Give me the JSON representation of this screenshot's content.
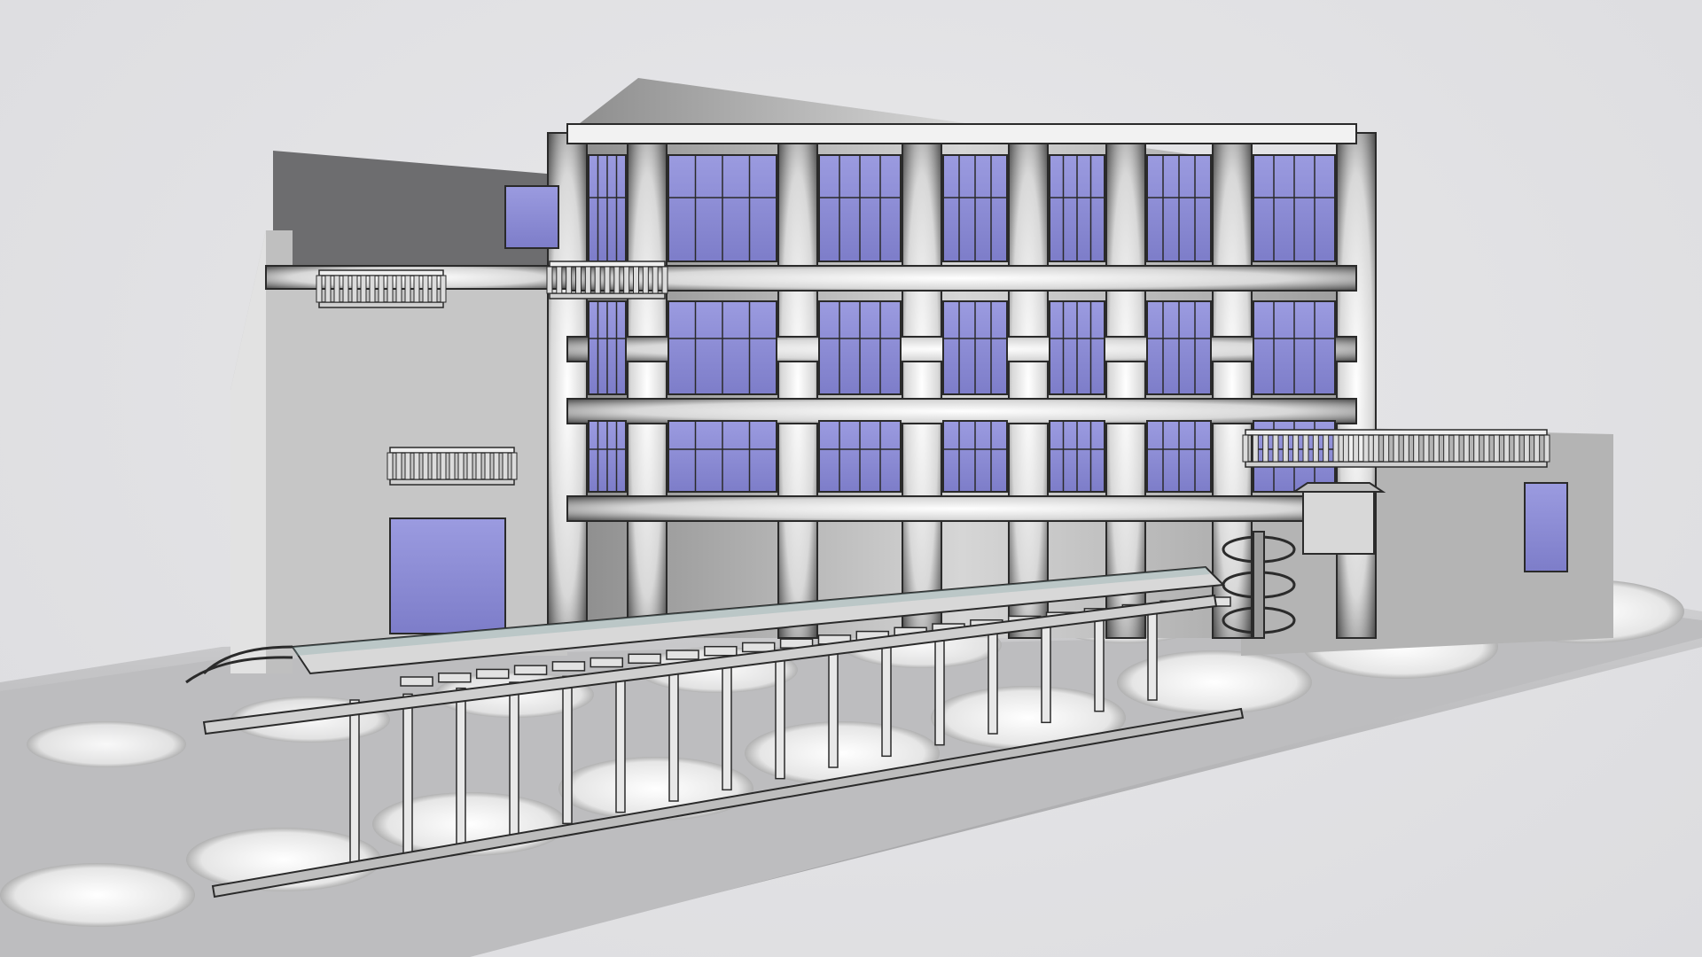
{
  "scene": {
    "subject": "",
    "render_style": "ambient-occlusion"
  },
  "colors": {
    "background": "#e4e4e6",
    "facade_light": "#f4f4f4",
    "facade_mid": "#b8b8b8",
    "facade_dark": "#3a3a3a",
    "glass": "#8f8fd6",
    "glass_light": "#b4b4ea",
    "mullion": "#2a2a2a",
    "ground_light": "#f7f7f7",
    "ground_dark": "#6f6f6f",
    "roof_dark": "#6d6d6f"
  }
}
